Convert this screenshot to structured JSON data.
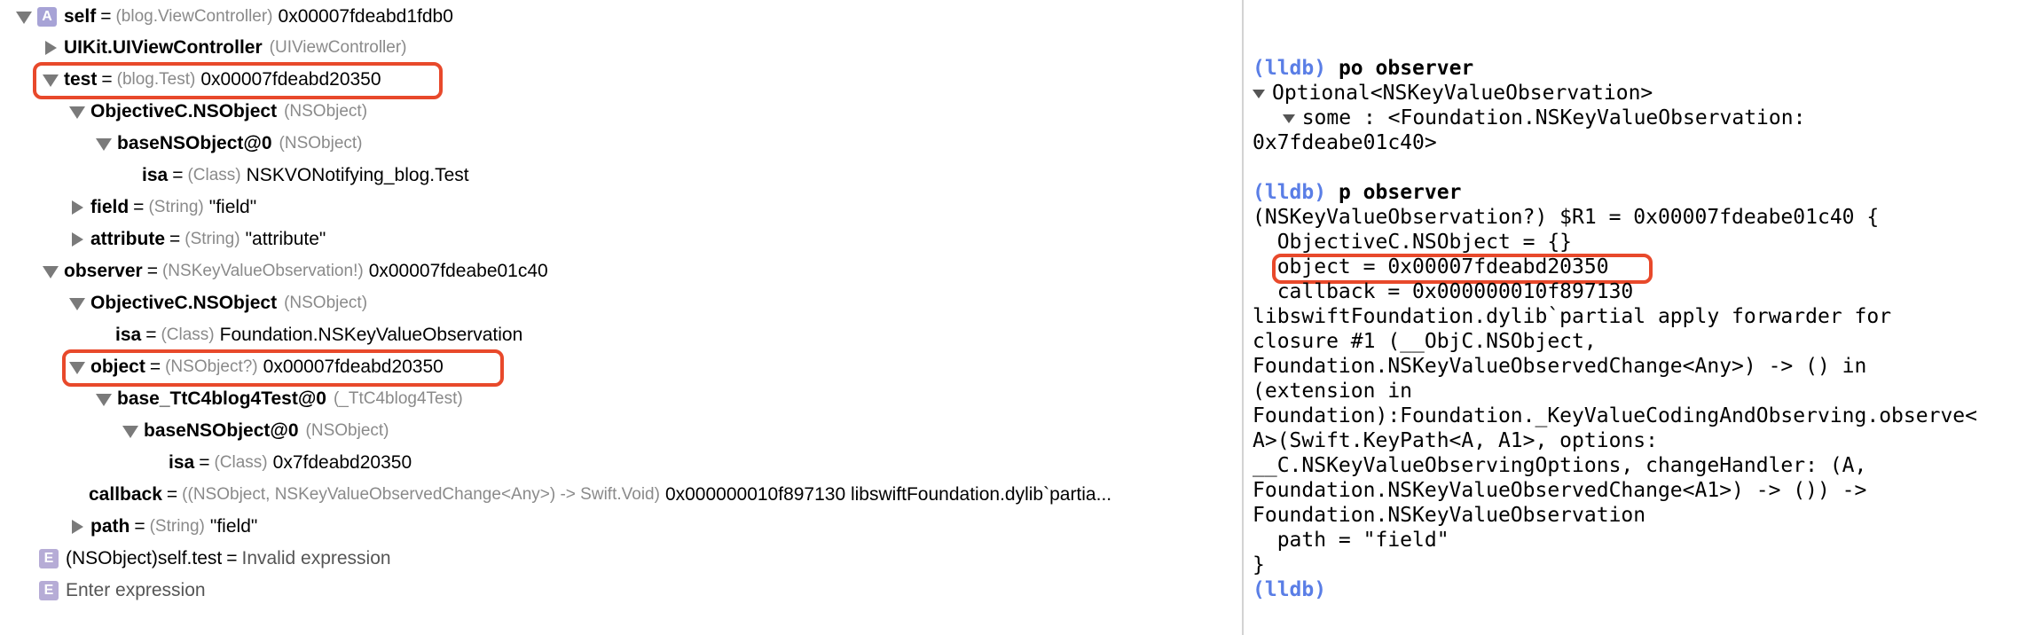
{
  "variables": {
    "self": {
      "name": "self",
      "type": "(blog.ViewController)",
      "value": "0x00007fdeabd1fdb0",
      "badge": "A"
    },
    "uikit": {
      "name": "UIKit.UIViewController",
      "type": "(UIViewController)"
    },
    "test": {
      "name": "test",
      "type": "(blog.Test)",
      "value": "0x00007fdeabd20350"
    },
    "test_objc": {
      "name": "ObjectiveC.NSObject",
      "type": "(NSObject)"
    },
    "test_base": {
      "name": "baseNSObject@0",
      "type": "(NSObject)"
    },
    "test_isa": {
      "name": "isa",
      "type": "(Class)",
      "value": "NSKVONotifying_blog.Test"
    },
    "field": {
      "name": "field",
      "type": "(String)",
      "value": "\"field\""
    },
    "attribute": {
      "name": "attribute",
      "type": "(String)",
      "value": "\"attribute\""
    },
    "observer": {
      "name": "observer",
      "type": "(NSKeyValueObservation!)",
      "value": "0x00007fdeabe01c40"
    },
    "obs_objc": {
      "name": "ObjectiveC.NSObject",
      "type": "(NSObject)"
    },
    "obs_isa": {
      "name": "isa",
      "type": "(Class)",
      "value": "Foundation.NSKeyValueObservation"
    },
    "object": {
      "name": "object",
      "type": "(NSObject?)",
      "value": "0x00007fdeabd20350"
    },
    "obj_base": {
      "name": "base_TtC4blog4Test@0",
      "type": "(_TtC4blog4Test)"
    },
    "obj_base2": {
      "name": "baseNSObject@0",
      "type": "(NSObject)"
    },
    "obj_isa": {
      "name": "isa",
      "type": "(Class)",
      "value": "0x7fdeabd20350"
    },
    "callback": {
      "name": "callback",
      "type": "((NSObject, NSKeyValueObservedChange<Any>) -> Swift.Void)",
      "value": "0x000000010f897130 libswiftFoundation.dylib`partia..."
    },
    "path": {
      "name": "path",
      "type": "(String)",
      "value": "\"field\""
    },
    "expr1": {
      "badge": "E",
      "name": "(NSObject)self.test",
      "value": "Invalid expression"
    },
    "expr2": {
      "badge": "E",
      "placeholder": "Enter expression"
    }
  },
  "console": {
    "prompt": "(lldb)",
    "cmd1": "po observer",
    "out1": [
      "Optional<NSKeyValueObservation>",
      "some : <Foundation.NSKeyValueObservation:",
      "0x7fdeabe01c40>"
    ],
    "cmd2": "p observer",
    "out2": [
      "(NSKeyValueObservation?) $R1 = 0x00007fdeabe01c40 {",
      "  ObjectiveC.NSObject = {}",
      "  object = 0x00007fdeabd20350",
      "  callback = 0x000000010f897130",
      "libswiftFoundation.dylib`partial apply forwarder for",
      "closure #1 (__ObjC.NSObject,",
      "Foundation.NSKeyValueObservedChange<Any>) -> () in",
      "(extension in",
      "Foundation):Foundation._KeyValueCodingAndObserving.observe<",
      "A>(Swift.KeyPath<A, A1>, options:",
      "__C.NSKeyValueObservingOptions, changeHandler: (A,",
      "Foundation.NSKeyValueObservedChange<A1>) -> ()) ->",
      "Foundation.NSKeyValueObservation",
      "  path = \"field\"",
      "}"
    ],
    "prompt_end": "(lldb)"
  },
  "colors": {
    "highlight": "#e8492b",
    "lldb_prompt": "#5a7ee6",
    "type_gray": "#8a8a8a"
  }
}
